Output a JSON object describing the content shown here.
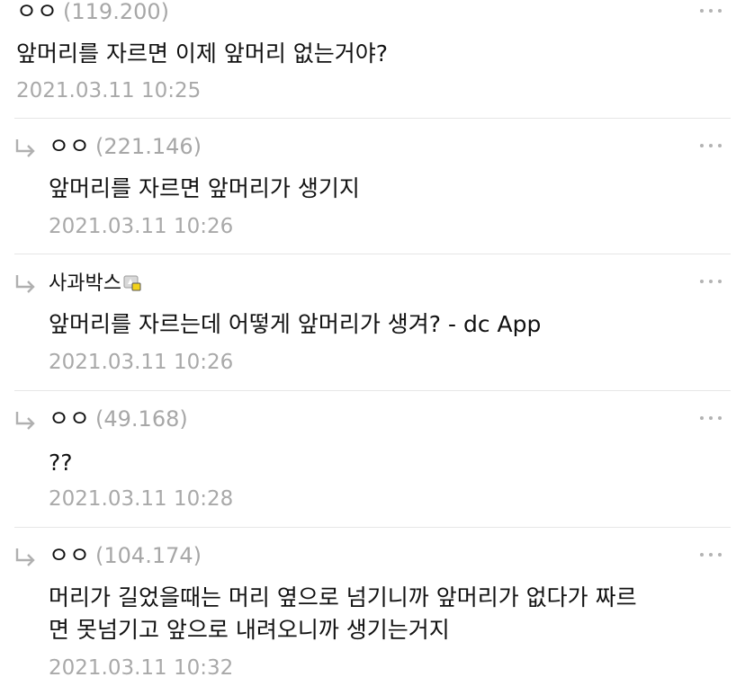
{
  "comments": [
    {
      "writer": "ㅇㅇ",
      "ip": "(119.200)",
      "is_reply": false,
      "text": "앞머리를 자르면 이제 앞머리 없는거야?",
      "time": "2021.03.11 10:25"
    },
    {
      "writer": "ㅇㅇ",
      "ip": "(221.146)",
      "is_reply": true,
      "text": "앞머리를 자르면 앞머리가 생기지",
      "time": "2021.03.11 10:26"
    },
    {
      "writer": "사과박스",
      "ip": "",
      "is_reply": true,
      "badge": "fixed-nickname-icon",
      "text": "앞머리를 자르는데 어떻게 앞머리가 생겨?  - dc App",
      "time": "2021.03.11 10:26"
    },
    {
      "writer": "ㅇㅇ",
      "ip": "(49.168)",
      "is_reply": true,
      "text": "??",
      "time": "2021.03.11 10:28"
    },
    {
      "writer": "ㅇㅇ",
      "ip": "(104.174)",
      "is_reply": true,
      "text_line1": "머리가 길었을때는 머리 옆으로 넘기니까 앞머리가 없다가 짜르",
      "text_line2": "면 못넘기고 앞으로 내려오니까 생기는거지",
      "time": "2021.03.11 10:32"
    }
  ],
  "icons": {
    "more": "more-dots-icon",
    "reply": "reply-arrow-icon"
  },
  "colors": {
    "meta_gray": "#a9a9a9",
    "divider": "#e6e6e6",
    "badge_yellow": "#f2d21b"
  }
}
